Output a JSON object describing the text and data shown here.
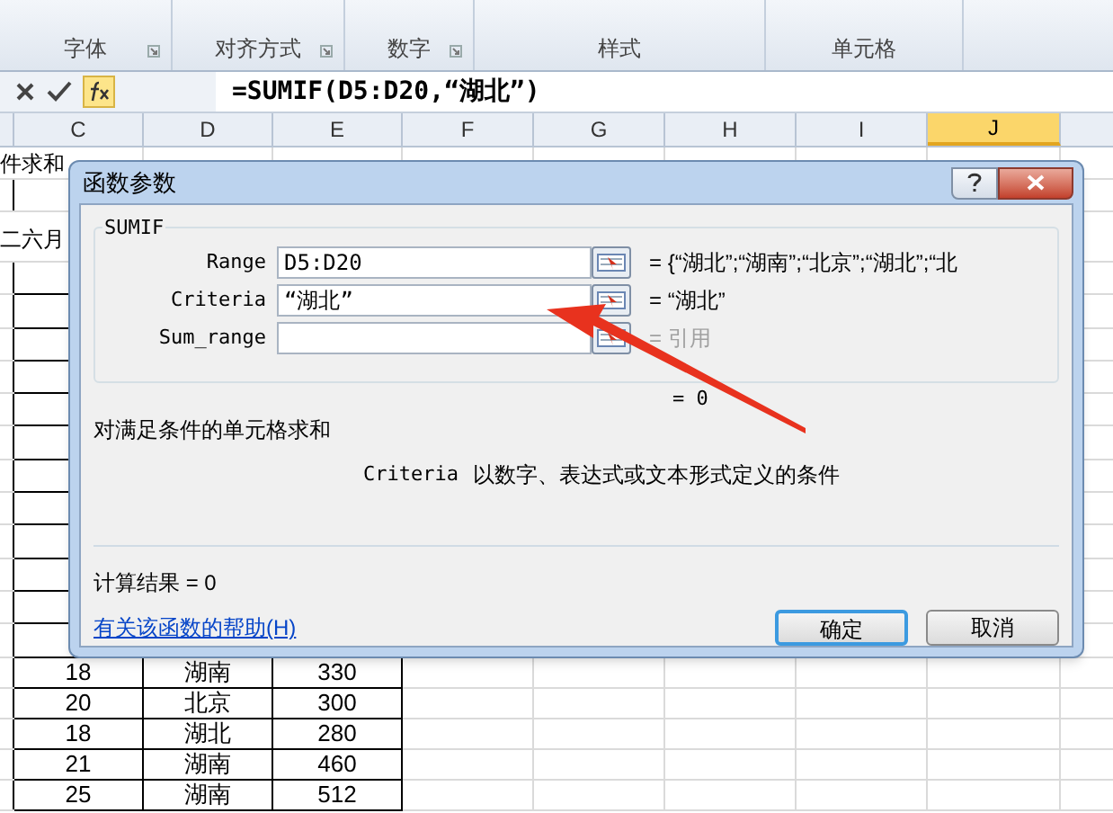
{
  "ribbon_groups": [
    {
      "label": "字体",
      "launcher": true
    },
    {
      "label": "对齐方式",
      "launcher": true
    },
    {
      "label": "数字",
      "launcher": true
    },
    {
      "label": "样式",
      "launcher": false
    },
    {
      "label": "单元格",
      "launcher": false
    }
  ],
  "formula_bar": {
    "formula": "=SUMIF(D5:D20,“湖北”)"
  },
  "columns": [
    {
      "label": "C",
      "selected": false
    },
    {
      "label": "D",
      "selected": false
    },
    {
      "label": "E",
      "selected": false
    },
    {
      "label": "F",
      "selected": false
    },
    {
      "label": "G",
      "selected": false
    },
    {
      "label": "H",
      "selected": false
    },
    {
      "label": "I",
      "selected": false
    },
    {
      "label": "J",
      "selected": true
    }
  ],
  "sheet_texts": [
    "件求和",
    "二六月"
  ],
  "data_rows": [
    [
      "18",
      "湖南",
      "330"
    ],
    [
      "20",
      "北京",
      "300"
    ],
    [
      "18",
      "湖北",
      "280"
    ],
    [
      "21",
      "湖南",
      "460"
    ],
    [
      "25",
      "湖南",
      "512"
    ]
  ],
  "dialog": {
    "title": "函数参数",
    "function_name": "SUMIF",
    "params": [
      {
        "name": "Range",
        "value": "D5:D20",
        "result": "= {“湖北”;“湖南”;“北京”;“湖北”;“北",
        "result_dimmed": false
      },
      {
        "name": "Criteria",
        "value": "“湖北”",
        "result": "= “湖北”",
        "result_dimmed": false
      },
      {
        "name": "Sum_range",
        "result": "= 引用",
        "result_dimmed": true
      }
    ],
    "formula_result": "= 0",
    "description": "对满足条件的单元格求和",
    "arg_name": "Criteria",
    "arg_help": "以数字、表达式或文本形式定义的条件",
    "calc_result": "计算结果 = 0",
    "help_link": "有关该函数的帮助(H)",
    "buttons": [
      {
        "label": "确定",
        "default": true
      },
      {
        "label": "取消",
        "default": false
      }
    ]
  }
}
